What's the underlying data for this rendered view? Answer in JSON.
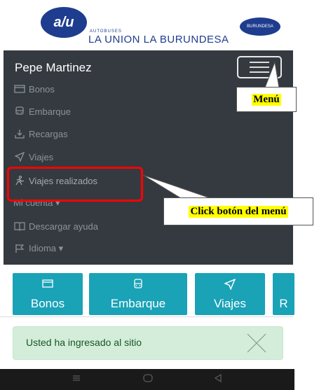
{
  "header": {
    "logo_text": "a/u",
    "brand_small": "AUTOBUSES",
    "brand_name": "LA UNION LA BURUNDESA",
    "brand_oval_text": "BURUNDESA"
  },
  "nav": {
    "user_name": "Pepe Martinez",
    "items": [
      {
        "label": "Bonos",
        "icon": "ticket-icon"
      },
      {
        "label": "Embarque",
        "icon": "bus-icon"
      },
      {
        "label": "Recargas",
        "icon": "download-icon"
      },
      {
        "label": "Viajes",
        "icon": "send-icon"
      },
      {
        "label": "Viajes realizados",
        "icon": "walking-icon"
      },
      {
        "label": "Mi cuenta ▾",
        "icon": ""
      },
      {
        "label": "Descargar ayuda",
        "icon": "book-icon"
      },
      {
        "label": "Idioma ▾",
        "icon": "flag-icon"
      }
    ]
  },
  "annotations": {
    "menu_label": "Menú",
    "click_label": "Click botón del menú"
  },
  "tiles": [
    {
      "label": "Bonos",
      "icon": "ticket-icon"
    },
    {
      "label": "Embarque",
      "icon": "bus-icon"
    },
    {
      "label": "Viajes",
      "icon": "send-icon"
    },
    {
      "label": "R",
      "icon": ""
    }
  ],
  "alert": {
    "text": "Usted ha ingresado al sitio"
  },
  "colors": {
    "nav_bg": "#343a40",
    "tile_bg": "#1aa2b7",
    "alert_bg": "#d4edda",
    "highlight": "#ff0000",
    "callout": "#ffff00"
  }
}
